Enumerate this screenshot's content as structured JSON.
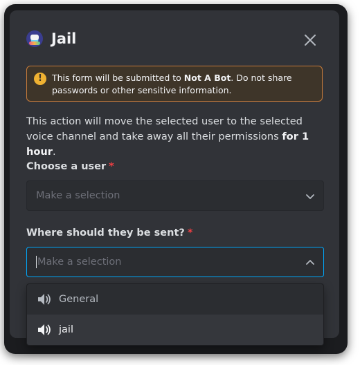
{
  "modal": {
    "title": "Jail",
    "warning_prefix": "This form will be submitted to ",
    "warning_bot": "Not A Bot",
    "warning_suffix": ". Do not share passwords or other sensitive information.",
    "description_prefix": "This action will move the selected user to the selected voice channel and take away all their permissions ",
    "description_bold": "for 1 hour",
    "description_suffix": "."
  },
  "fields": {
    "user": {
      "label": "Choose a user",
      "required_mark": "*",
      "placeholder": "Make a selection"
    },
    "channel": {
      "label": "Where should they be sent?",
      "required_mark": "*",
      "placeholder": "Make a selection",
      "options": [
        {
          "label": "General",
          "icon": "speaker-icon"
        },
        {
          "label": "jail",
          "icon": "speaker-icon"
        }
      ]
    }
  },
  "colors": {
    "background": "#313338",
    "input": "#2b2d31",
    "focus_border": "#00a8fc",
    "warning_border": "#c77b3b",
    "required": "#f23f43",
    "accent_button": "#5865f2"
  }
}
